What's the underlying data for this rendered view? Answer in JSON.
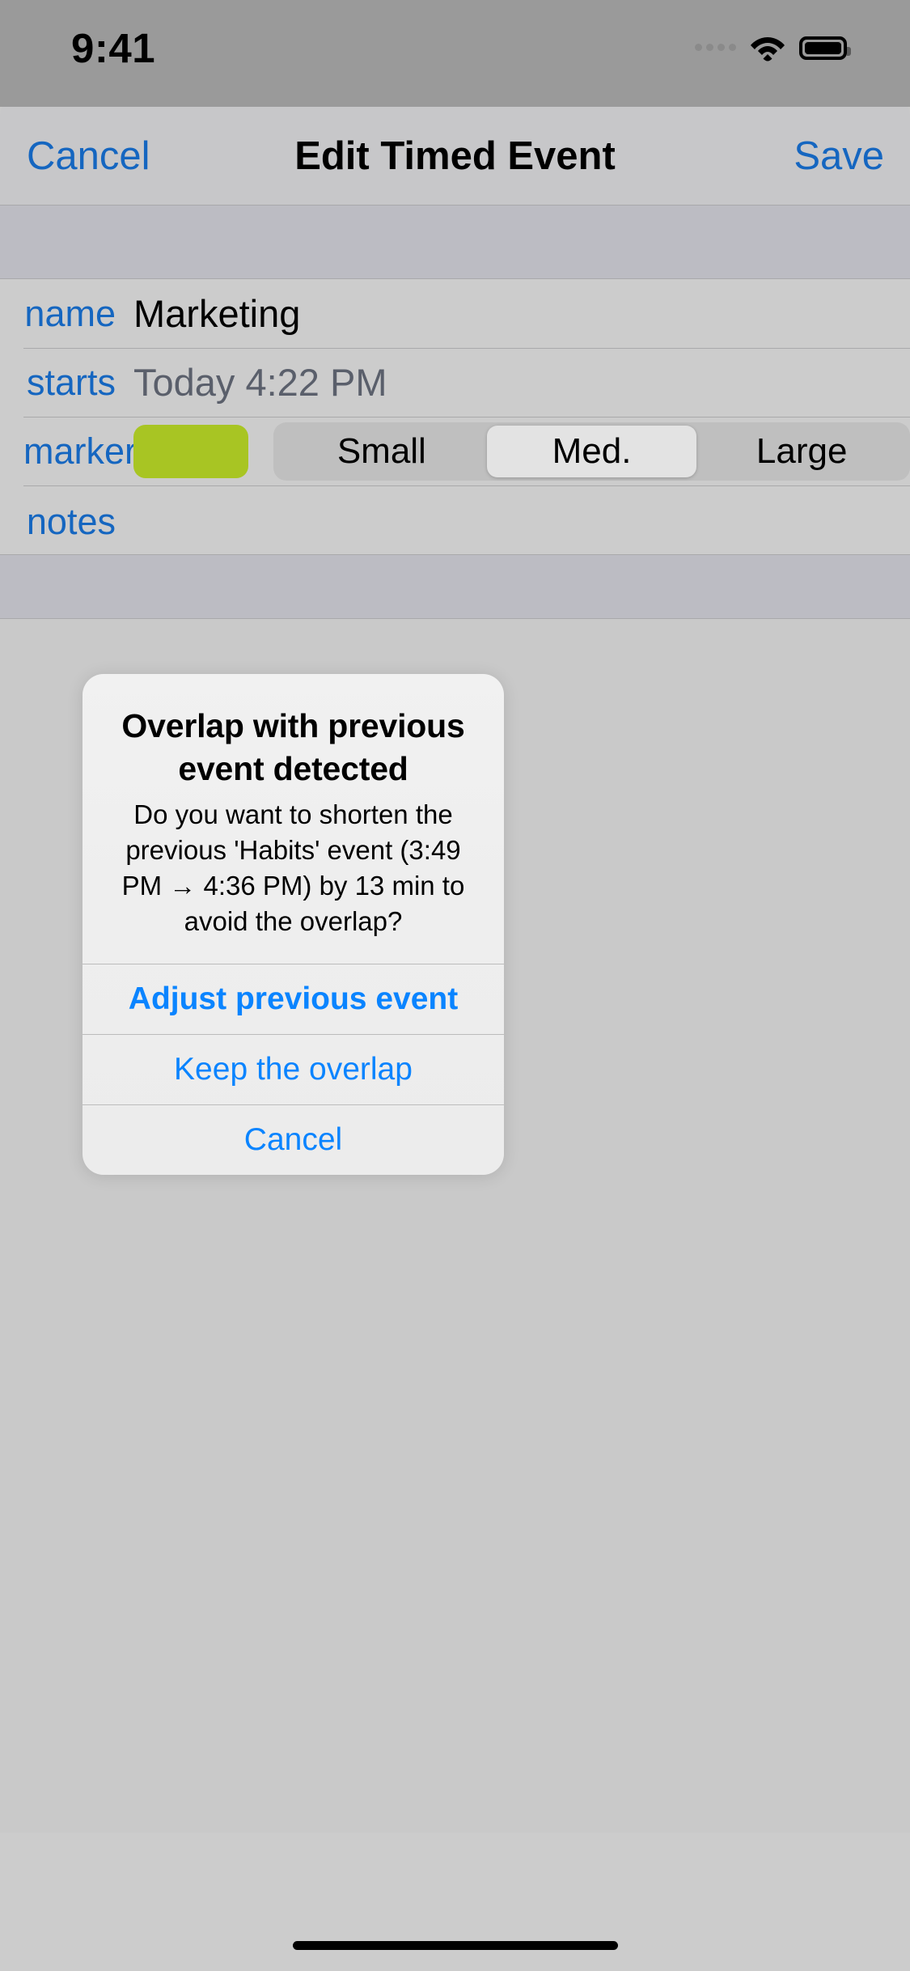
{
  "status_bar": {
    "time": "9:41",
    "signal_icon": "signal-dots-icon",
    "wifi_icon": "wifi-icon",
    "battery_icon": "battery-icon"
  },
  "navbar": {
    "cancel_label": "Cancel",
    "title": "Edit Timed Event",
    "save_label": "Save"
  },
  "form": {
    "name": {
      "label": "name",
      "value": "Marketing"
    },
    "starts": {
      "label": "starts",
      "day": "Today",
      "time": "4:22 PM",
      "value": "Today  4:22 PM"
    },
    "marker": {
      "label": "marker",
      "swatch_color": "#a8c523",
      "sizes": [
        {
          "label": "Small",
          "selected": false
        },
        {
          "label": "Med.",
          "selected": true
        },
        {
          "label": "Large",
          "selected": false
        }
      ],
      "size_0": "Small",
      "size_1": "Med.",
      "size_2": "Large"
    },
    "notes": {
      "label": "notes",
      "value": ""
    }
  },
  "alert": {
    "title": "Overlap with previous event detected",
    "message": "Do you want to shorten the previous 'Habits' event (3:49 PM → 4:36 PM) by 13 min to avoid the overlap?",
    "previous_event_name": "Habits",
    "previous_event_start": "3:49 PM",
    "previous_event_end": "4:36 PM",
    "shorten_by": "13 min",
    "buttons": [
      {
        "label": "Adjust previous event",
        "emphasis": "bold"
      },
      {
        "label": "Keep the overlap",
        "emphasis": "normal"
      },
      {
        "label": "Cancel",
        "emphasis": "normal"
      }
    ],
    "button_0": "Adjust previous event",
    "button_1": "Keep the overlap",
    "button_2": "Cancel"
  },
  "colors": {
    "accent_blue": "#0a84ff",
    "label_blue": "#1566c0",
    "marker_green": "#a8c523"
  }
}
